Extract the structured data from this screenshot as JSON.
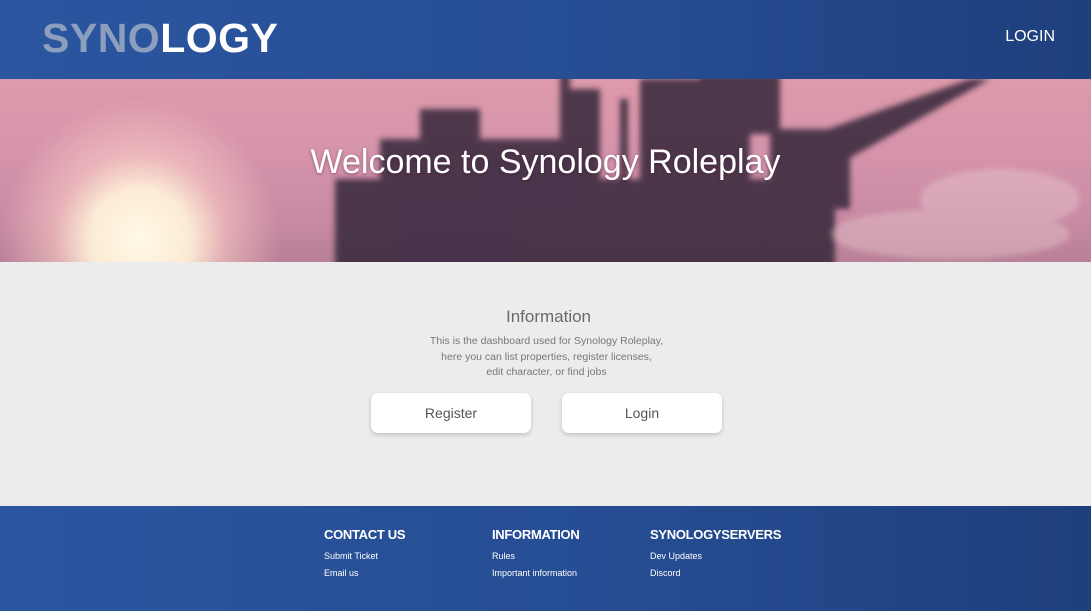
{
  "header": {
    "logo_part1": "SYNO",
    "logo_part2": "LOGY",
    "login_label": "LOGIN"
  },
  "hero": {
    "title": "Welcome to Synology Roleplay"
  },
  "info": {
    "title": "Information",
    "lines": [
      "This is the dashboard used for Synology Roleplay,",
      "here you can list properties, register licenses,",
      "edit character, or find jobs"
    ],
    "register_label": "Register",
    "login_label": "Login"
  },
  "footer": {
    "columns": [
      {
        "title": "CONTACT US",
        "links": [
          "Submit Ticket",
          "Email us"
        ]
      },
      {
        "title": "INFORMATION",
        "links": [
          "Rules",
          "Important information"
        ]
      },
      {
        "title": "SYNOLOGYSERVERS",
        "links": [
          "Dev Updates",
          "Discord"
        ]
      }
    ]
  },
  "colors": {
    "brand_blue": "#2b56a0",
    "brand_blue_dark": "#1f3f7d",
    "page_bg": "#ececec"
  }
}
